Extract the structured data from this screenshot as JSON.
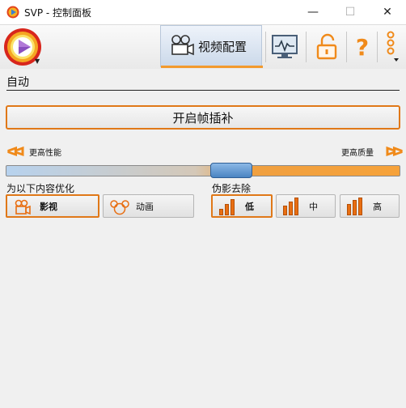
{
  "window": {
    "title": "SVP - 控制面板"
  },
  "toolbar": {
    "video_tab_label": "视频配置",
    "help_label": "?"
  },
  "mode": {
    "label": "自动"
  },
  "interp_button_label": "开启帧插补",
  "slider": {
    "left_label": "更高性能",
    "right_label": "更高质量",
    "value": 0.58
  },
  "optimize": {
    "label": "为以下内容优化",
    "options": [
      {
        "label": "影视",
        "icon": "film-camera-icon",
        "selected": true
      },
      {
        "label": "动画",
        "icon": "mouse-cartoon-icon",
        "selected": false
      }
    ]
  },
  "artifact": {
    "label": "伪影去除",
    "options": [
      {
        "label": "低",
        "selected": true
      },
      {
        "label": "中",
        "selected": false
      },
      {
        "label": "高",
        "selected": false
      }
    ]
  },
  "colors": {
    "accent": "#e07818",
    "slider_thumb": "#4a84c2"
  }
}
